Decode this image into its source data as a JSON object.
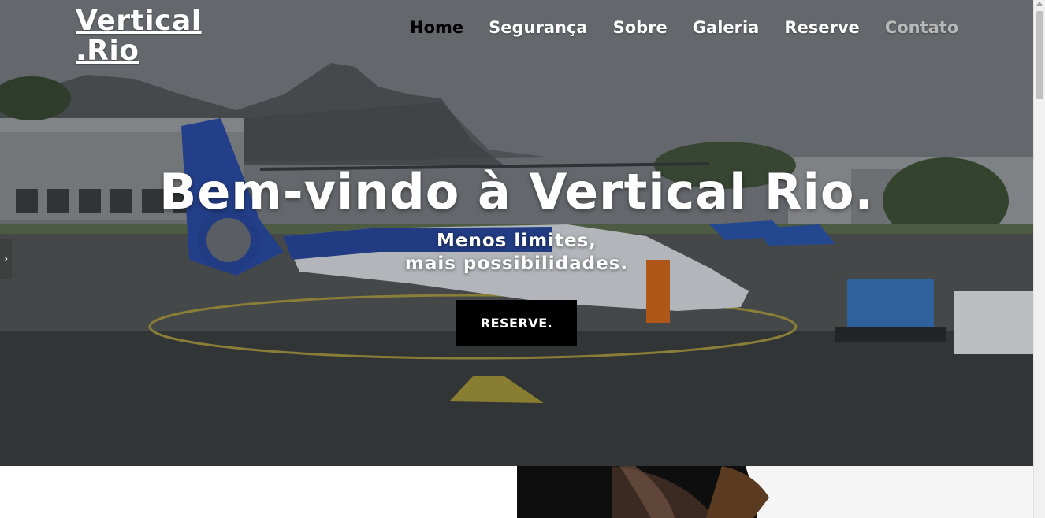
{
  "brand": {
    "line1": "Vertical",
    "line2": ".Rio"
  },
  "nav": {
    "items": [
      {
        "label": "Home",
        "state": "active"
      },
      {
        "label": "Segurança",
        "state": "default"
      },
      {
        "label": "Sobre",
        "state": "default"
      },
      {
        "label": "Galeria",
        "state": "default"
      },
      {
        "label": "Reserve",
        "state": "default"
      },
      {
        "label": "Contato",
        "state": "muted"
      }
    ]
  },
  "hero": {
    "title": "Bem-vindo à Vertical Rio.",
    "subtitle_line1": "Menos limites,",
    "subtitle_line2": "mais possibilidades.",
    "cta_label": "RESERVE.",
    "background": "helicopter-on-helipad-photo"
  },
  "side_toggle": {
    "icon": "chevron-right-icon",
    "glyph": "›"
  },
  "colors": {
    "nav_text": "#ffffff",
    "nav_active": "#000000",
    "nav_muted": "#b8b8b8",
    "cta_bg": "#000000",
    "cta_text": "#ffffff"
  }
}
